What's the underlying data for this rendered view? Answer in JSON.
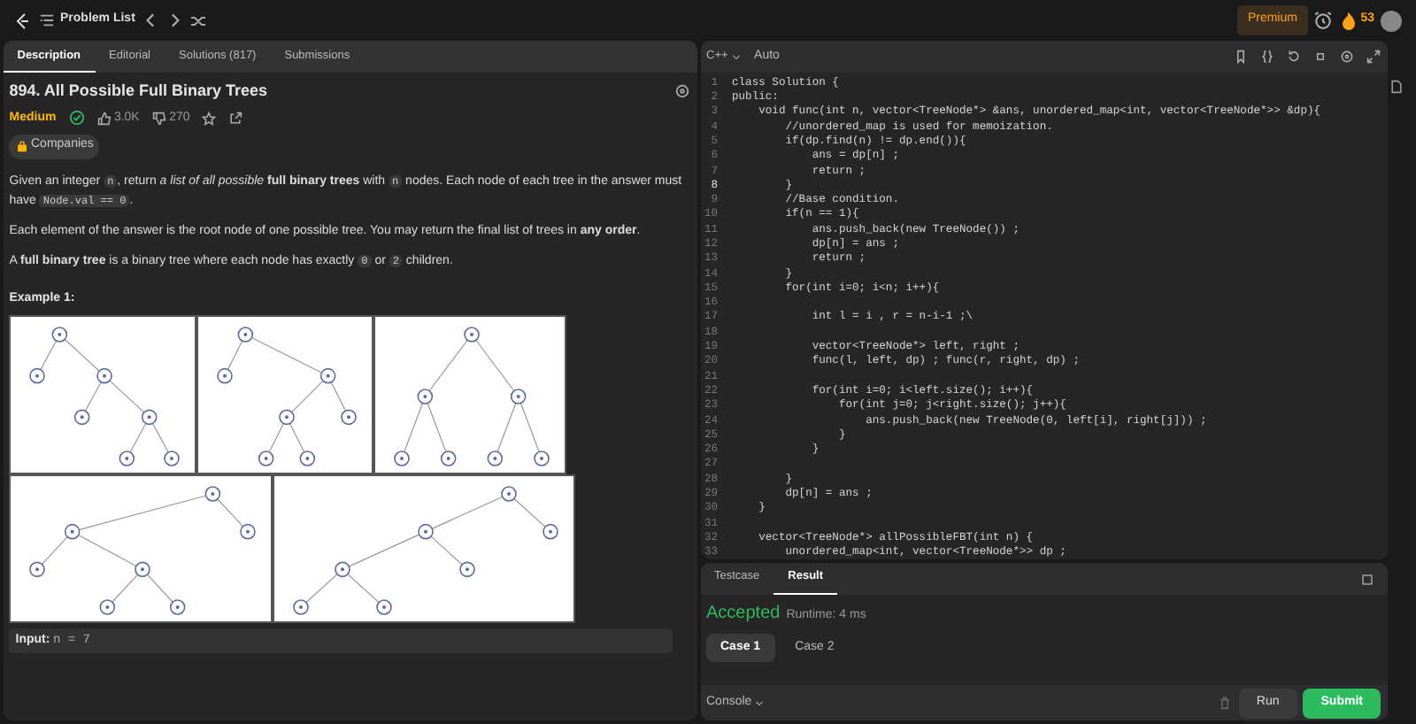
{
  "top_bar": {
    "problem_list": "Problem List",
    "premium": "Premium",
    "streak": "53"
  },
  "description_tabs": [
    {
      "label": "Description",
      "selected": true
    },
    {
      "label": "Editorial",
      "selected": false
    },
    {
      "label": "Solutions (817)",
      "selected": false
    },
    {
      "label": "Submissions",
      "selected": false
    }
  ],
  "problem": {
    "title": "894. All Possible Full Binary Trees",
    "difficulty": "Medium",
    "solved": true,
    "likes": "3.0K",
    "dislikes": "270",
    "companies": "Companies",
    "paragraphs": [
      [
        {
          "kind": "text",
          "text": "Given an integer "
        },
        {
          "kind": "code",
          "text": "n"
        },
        {
          "kind": "text",
          "text": ", return *a list of all possible* **full binary trees** with "
        },
        {
          "kind": "code",
          "text": "n"
        },
        {
          "kind": "text",
          "text": " nodes. Each node of each tree in the answer must have "
        },
        {
          "kind": "code",
          "text": "Node.val == 0"
        },
        {
          "kind": "text",
          "text": "."
        }
      ],
      [
        {
          "kind": "text",
          "text": "Each element of the answer is the root node of one possible tree. You may return the final list of trees in **any order**."
        }
      ],
      [
        {
          "kind": "text",
          "text": "A **full binary tree** is a binary tree where each node has exactly "
        },
        {
          "kind": "code",
          "text": "0"
        },
        {
          "kind": "text",
          "text": " or "
        },
        {
          "kind": "code",
          "text": "2"
        },
        {
          "kind": "text",
          "text": " children."
        }
      ]
    ],
    "example_title": "Example 1:",
    "input_label": "Input:",
    "input_value": "n = 7"
  },
  "editor": {
    "language": "C++",
    "mode": "Auto",
    "lines": [
      {
        "number": "1",
        "current": false,
        "text": "class Solution {"
      },
      {
        "number": "2",
        "current": false,
        "text": "public:"
      },
      {
        "number": "3",
        "current": false,
        "text": "    void func(int n, vector<TreeNode*> &ans, unordered_map<int, vector<TreeNode*>> &dp){"
      },
      {
        "number": "4",
        "current": false,
        "text": "        //unordered_map is used for memoization."
      },
      {
        "number": "5",
        "current": false,
        "text": "        if(dp.find(n) != dp.end()){"
      },
      {
        "number": "6",
        "current": false,
        "text": "            ans = dp[n] ;"
      },
      {
        "number": "7",
        "current": false,
        "text": "            return ;"
      },
      {
        "number": "8",
        "current": true,
        "text": "        }"
      },
      {
        "number": "9",
        "current": false,
        "text": "        //Base condition."
      },
      {
        "number": "10",
        "current": false,
        "text": "        if(n == 1){"
      },
      {
        "number": "11",
        "current": false,
        "text": "            ans.push_back(new TreeNode()) ;"
      },
      {
        "number": "12",
        "current": false,
        "text": "            dp[n] = ans ;"
      },
      {
        "number": "13",
        "current": false,
        "text": "            return ;"
      },
      {
        "number": "14",
        "current": false,
        "text": "        }"
      },
      {
        "number": "15",
        "current": false,
        "text": "        for(int i=0; i<n; i++){"
      },
      {
        "number": "16",
        "current": false
      },
      {
        "number": "17",
        "current": false,
        "text": "            int l = i , r = n-i-1 ;\\"
      },
      {
        "number": "18",
        "current": false
      },
      {
        "number": "19",
        "current": false,
        "text": "            vector<TreeNode*> left, right ;"
      },
      {
        "number": "20",
        "current": false,
        "text": "            func(l, left, dp) ; func(r, right, dp) ;"
      },
      {
        "number": "21",
        "current": false
      },
      {
        "number": "22",
        "current": false,
        "text": "            for(int i=0; i<left.size(); i++){"
      },
      {
        "number": "23",
        "current": false,
        "text": "                for(int j=0; j<right.size(); j++){"
      },
      {
        "number": "24",
        "current": false,
        "text": "                    ans.push_back(new TreeNode(0, left[i], right[j])) ;"
      },
      {
        "number": "25",
        "current": false,
        "text": "                }"
      },
      {
        "number": "26",
        "current": false,
        "text": "            }"
      },
      {
        "number": "27",
        "current": false
      },
      {
        "number": "28",
        "current": false,
        "text": "        }"
      },
      {
        "number": "29",
        "current": false,
        "text": "        dp[n] = ans ;"
      },
      {
        "number": "30",
        "current": false,
        "text": "    }"
      },
      {
        "number": "31",
        "current": false
      },
      {
        "number": "32",
        "current": false,
        "text": "    vector<TreeNode*> allPossibleFBT(int n) {"
      },
      {
        "number": "33",
        "current": false,
        "text": "        unordered_map<int, vector<TreeNode*>> dp ;"
      }
    ]
  },
  "result_tabs": [
    {
      "label": "Testcase",
      "selected": false
    },
    {
      "label": "Result",
      "selected": true
    }
  ],
  "result": {
    "verdict": "Accepted",
    "runtime": "Runtime: 4 ms",
    "cases": [
      {
        "label": "Case 1",
        "selected": true
      },
      {
        "label": "Case 2",
        "selected": false
      }
    ]
  },
  "footer": {
    "console": "Console",
    "run": "Run",
    "submit": "Submit"
  }
}
